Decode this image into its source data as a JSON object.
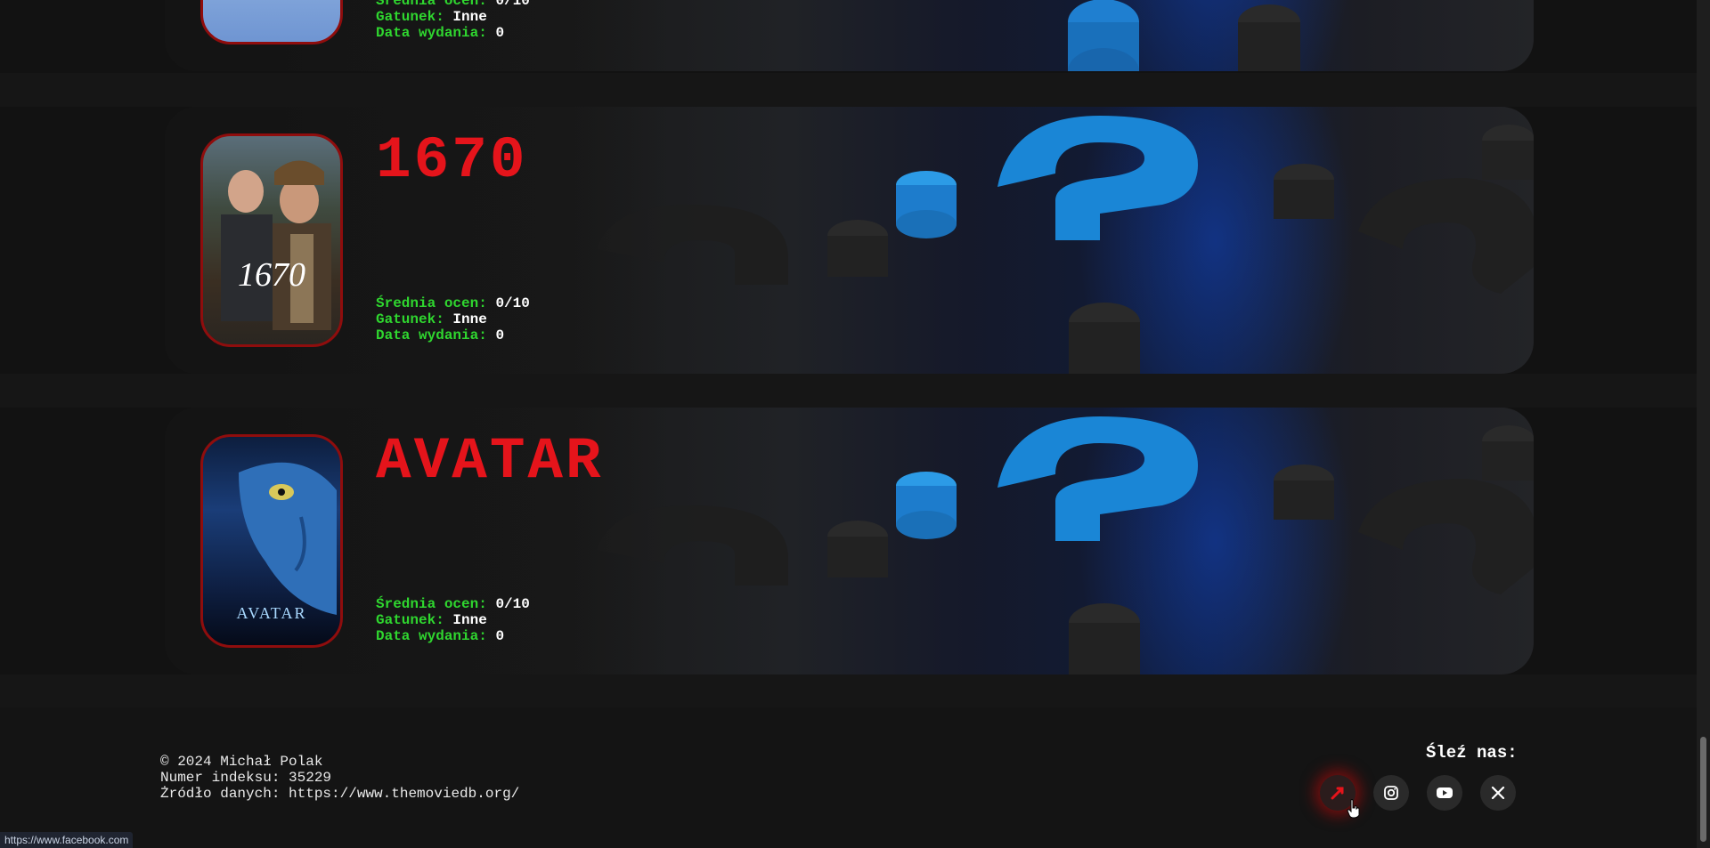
{
  "movies": [
    {
      "title": "",
      "rating_label": "Średnia ocen:",
      "rating": "0/10",
      "genre_label": "Gatunek:",
      "genre": "Inne",
      "date_label": "Data wydania:",
      "date": "0"
    },
    {
      "title": "1670",
      "poster_text": "1670",
      "rating_label": "Średnia ocen:",
      "rating": "0/10",
      "genre_label": "Gatunek:",
      "genre": "Inne",
      "date_label": "Data wydania:",
      "date": "0"
    },
    {
      "title": "AVATAR",
      "poster_text": "AVATAR",
      "rating_label": "Średnia ocen:",
      "rating": "0/10",
      "genre_label": "Gatunek:",
      "genre": "Inne",
      "date_label": "Data wydania:",
      "date": "0"
    }
  ],
  "footer": {
    "copyright": "© 2024 Michał Polak",
    "index": "Numer indeksu: 35229",
    "source": "Żródło danych: https://www.themoviedb.org/",
    "follow": "Śleź nas:",
    "socials": [
      "facebook-icon",
      "instagram-icon",
      "youtube-icon",
      "x-icon"
    ]
  },
  "status_bar": "https://www.facebook.com",
  "colors": {
    "title": "#e5141b",
    "label": "#2fd62f",
    "value": "#ffffff",
    "background": "#121212"
  }
}
